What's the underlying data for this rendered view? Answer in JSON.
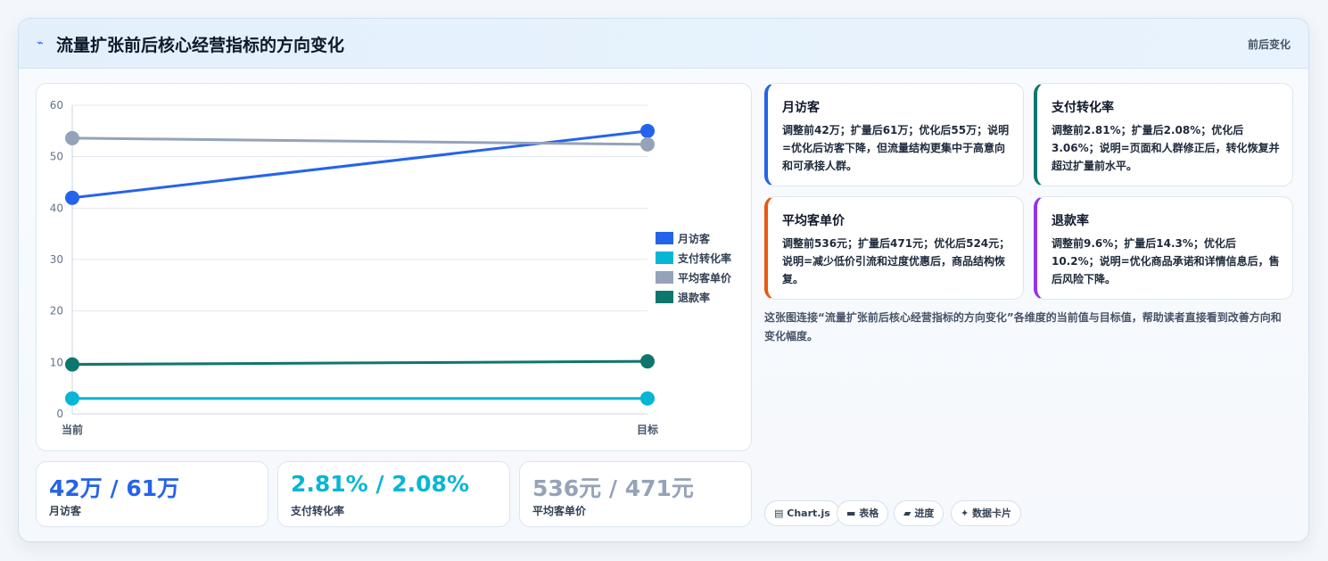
{
  "header": {
    "icon": "lightning-icon",
    "icon_glyph": "⌁",
    "title": "流量扩张前后核心经营指标的方向变化",
    "right_label": "前后变化"
  },
  "chart_data": {
    "type": "line",
    "categories": [
      "当前",
      "目标"
    ],
    "series": [
      {
        "name": "月访客",
        "values": [
          42,
          55
        ],
        "color": "#2563eb"
      },
      {
        "name": "支付转化率",
        "values": [
          3,
          3
        ],
        "color": "#06b6d4"
      },
      {
        "name": "平均客单价",
        "values": [
          53.6,
          52.4
        ],
        "color": "#94a3b8"
      },
      {
        "name": "退款率",
        "values": [
          9.6,
          10.2
        ],
        "color": "#0f766e"
      }
    ],
    "ylim": [
      0,
      60
    ],
    "yticks": [
      0,
      10,
      20,
      30,
      40,
      50,
      60
    ],
    "grid": true,
    "legend_position": "right"
  },
  "stats": [
    {
      "value": "42万 / 61万",
      "label": "月访客",
      "color": "#2563eb"
    },
    {
      "value": "2.81% / 2.08%",
      "label": "支付转化率",
      "color": "#06b6d4"
    },
    {
      "value": "536元 / 471元",
      "label": "平均客单价",
      "color": "#94a3b8"
    }
  ],
  "metric_cards": [
    {
      "title": "月访客",
      "desc": "调整前42万；扩量后61万；优化后55万；说明=优化后访客下降，但流量结构更集中于高意向和可承接人群。",
      "accent": "#2563eb"
    },
    {
      "title": "支付转化率",
      "desc": "调整前2.81%；扩量后2.08%；优化后3.06%；说明=页面和人群修正后，转化恢复并超过扩量前水平。",
      "accent": "#0f766e"
    },
    {
      "title": "平均客单价",
      "desc": "调整前536元；扩量后471元；优化后524元；说明=减少低价引流和过度优惠后，商品结构恢复。",
      "accent": "#ea580c"
    },
    {
      "title": "退款率",
      "desc": "调整前9.6%；扩量后14.3%；优化后10.2%；说明=优化商品承诺和详情信息后，售后风险下降。",
      "accent": "#9333ea"
    }
  ],
  "note": "这张图连接“流量扩张前后核心经营指标的方向变化”各维度的当前值与目标值，帮助读者直接看到改善方向和变化幅度。",
  "tags": [
    {
      "icon": "chart-icon",
      "glyph": "▤",
      "label": "Chart.js"
    },
    {
      "icon": "table-icon",
      "glyph": "▬",
      "label": "表格"
    },
    {
      "icon": "progress-icon",
      "glyph": "▰",
      "label": "进度"
    },
    {
      "icon": "sparkle-icon",
      "glyph": "✦",
      "label": "数据卡片"
    }
  ]
}
